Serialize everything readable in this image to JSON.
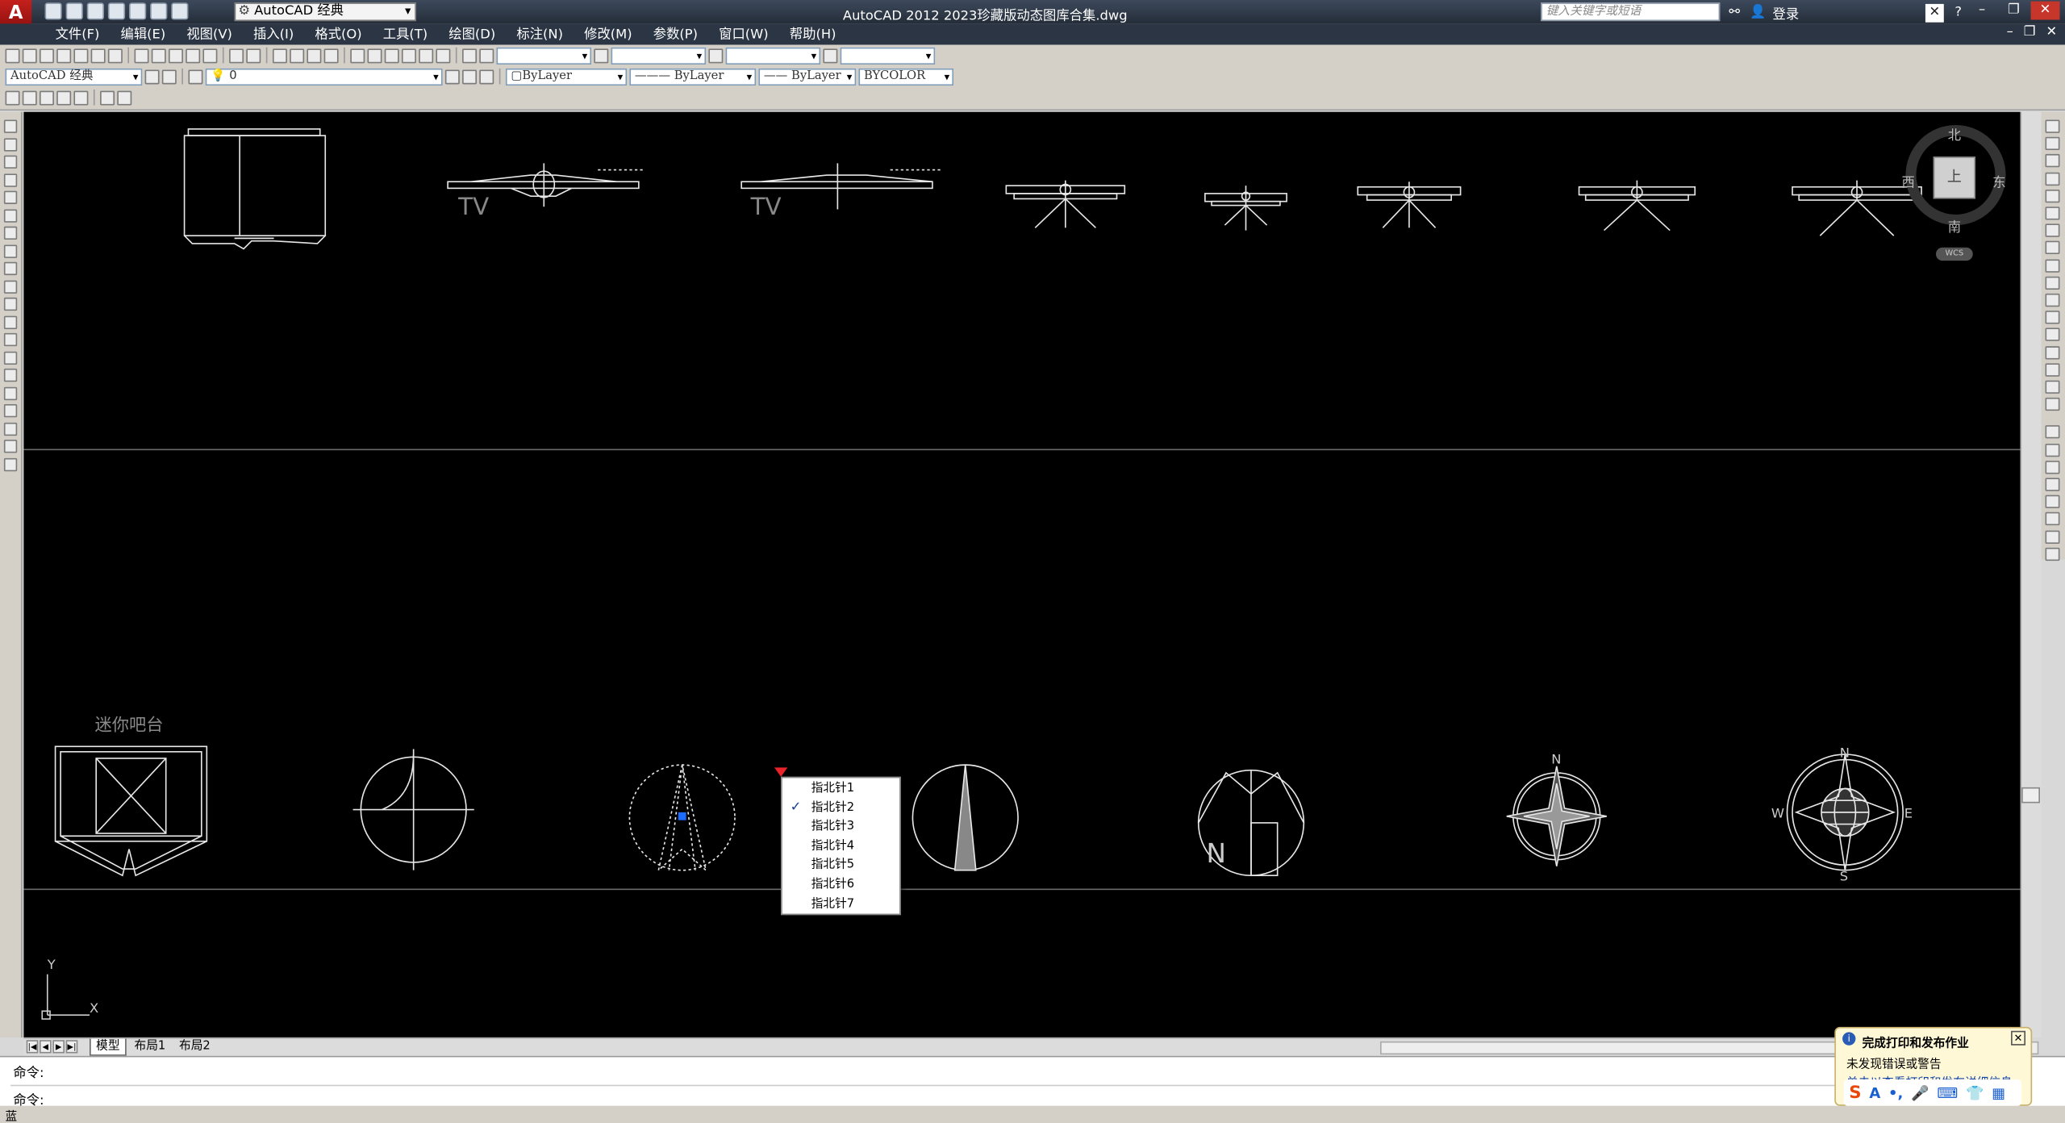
{
  "titlebar": {
    "logo": "A",
    "workspace": "AutoCAD 经典",
    "app_title": "AutoCAD 2012    2023珍藏版动态图库合集.dwg",
    "search_placeholder": "键入关键字或短语",
    "login": "登录"
  },
  "menu": {
    "items": [
      "文件(F)",
      "编辑(E)",
      "视图(V)",
      "插入(I)",
      "格式(O)",
      "工具(T)",
      "绘图(D)",
      "标注(N)",
      "修改(M)",
      "参数(P)",
      "窗口(W)",
      "帮助(H)"
    ]
  },
  "toolbar": {
    "workspace_dropdown": "AutoCAD 经典",
    "layer_value": "0",
    "color_value": "ByLayer",
    "linetype_value": "ByLayer",
    "lineweight_value": "ByLayer",
    "plotstyle_value": "BYCOLOR"
  },
  "canvas": {
    "bar_label": "迷你吧台",
    "tv_label_1": "TV",
    "tv_label_2": "TV",
    "compass_n": "N",
    "compass_s": "S",
    "compass_w": "W",
    "compass_e": "E",
    "north_arrow_n": "N",
    "ucs_y": "Y",
    "ucs_x": "X"
  },
  "viewcube": {
    "north": "北",
    "south": "南",
    "west": "西",
    "east": "东",
    "face": "上",
    "wcs": "WCS"
  },
  "popup_menu": {
    "items": [
      "指北针1",
      "指北针2",
      "指北针3",
      "指北针4",
      "指北针5",
      "指北针6",
      "指北针7"
    ],
    "checked_index": 1
  },
  "tabs": {
    "model": "模型",
    "layout1": "布局1",
    "layout2": "布局2"
  },
  "command": {
    "line1": "命令:",
    "line2": "命令:"
  },
  "notification": {
    "title": "完成打印和发布作业",
    "body": "未发现错误或警告",
    "link": "单击以查看打印和发布详细信息"
  },
  "status": {
    "coords": "蓝"
  }
}
